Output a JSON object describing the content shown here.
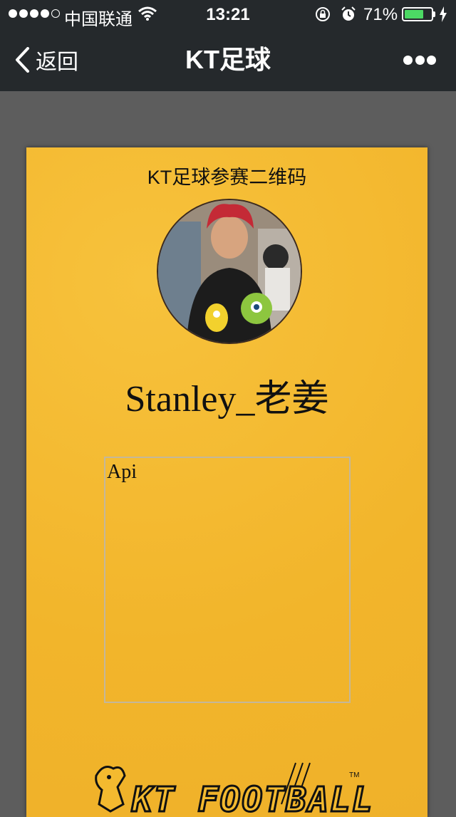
{
  "status_bar": {
    "carrier": "中国联通",
    "time": "13:21",
    "battery_percent": "71%",
    "battery_level": 0.71
  },
  "nav": {
    "back_label": "返回",
    "title": "KT足球"
  },
  "card": {
    "title": "KT足球参赛二维码",
    "username": "Stanley_老姜",
    "qr_alt_text": "Api",
    "logo_text": "KT FOOTBALL",
    "logo_tm": "TM"
  },
  "colors": {
    "bar_bg": "#25292c",
    "card_bg": "#f4ba2f",
    "battery_green": "#4cd964"
  }
}
